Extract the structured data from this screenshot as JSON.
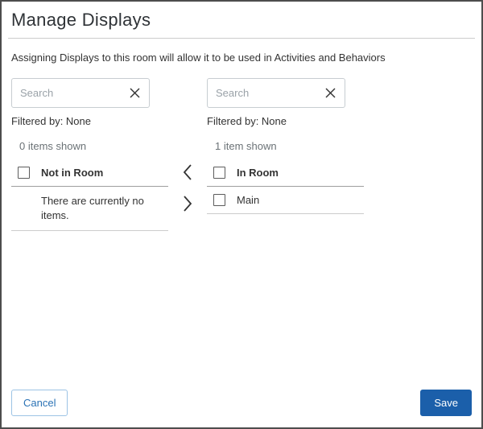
{
  "dialog": {
    "title": "Manage Displays",
    "description": "Assigning Displays to this room will allow it to be used in Activities and Behaviors"
  },
  "left_panel": {
    "search_placeholder": "Search",
    "filtered_by": "Filtered by: None",
    "items_shown": "0 items shown",
    "header": "Not in Room",
    "empty_message": "There are currently no items."
  },
  "right_panel": {
    "search_placeholder": "Search",
    "filtered_by": "Filtered by: None",
    "items_shown": "1 item shown",
    "header": "In Room",
    "items": [
      {
        "label": "Main"
      }
    ]
  },
  "transfer": {
    "move_left_icon": "chevron-left",
    "move_right_icon": "chevron-right"
  },
  "footer": {
    "cancel_label": "Cancel",
    "save_label": "Save"
  },
  "colors": {
    "accent_blue": "#1b5faa",
    "cancel_border": "#9cc3e5",
    "header_rule": "#9e9e9e"
  }
}
